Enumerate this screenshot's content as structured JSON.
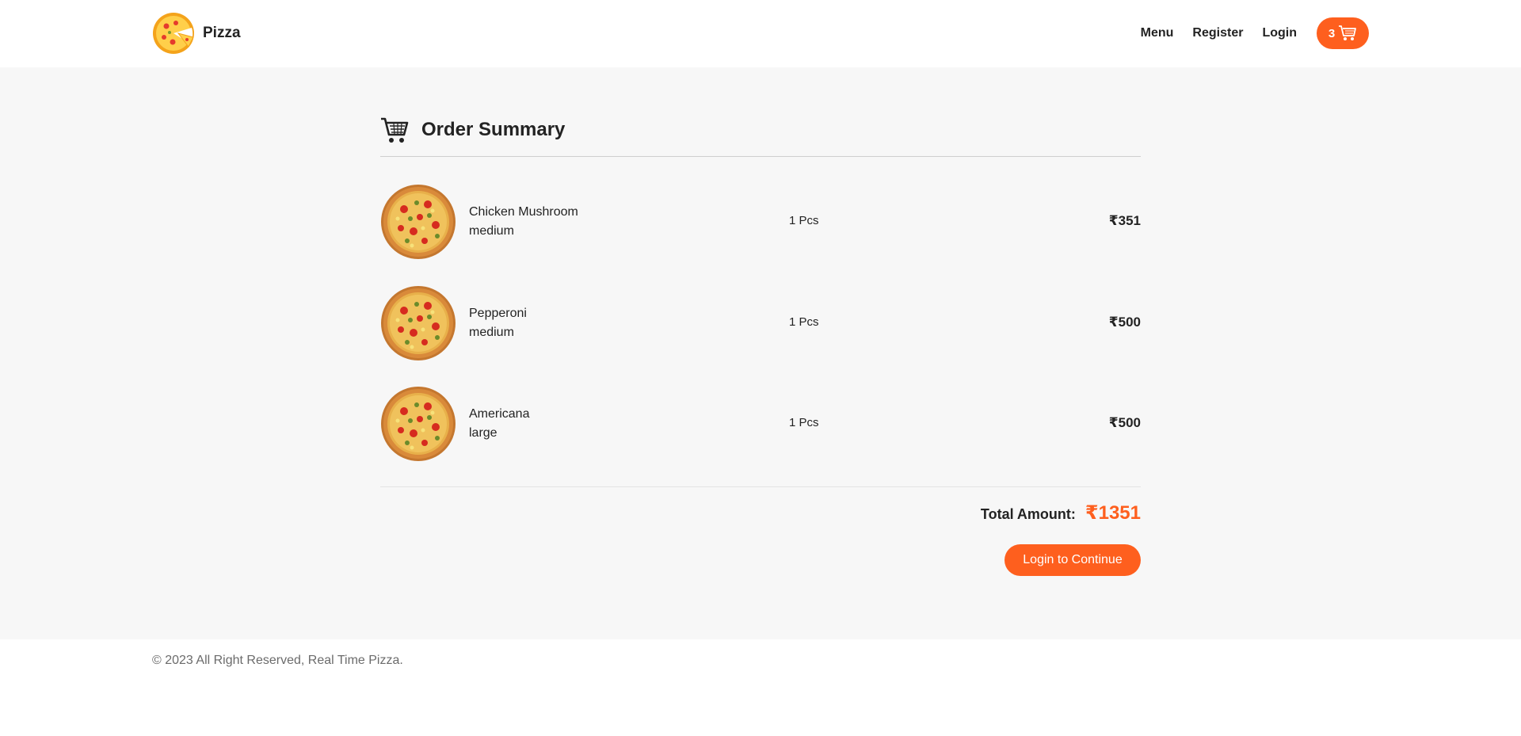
{
  "header": {
    "brand": "Pizza",
    "nav": {
      "menu": "Menu",
      "register": "Register",
      "login": "Login"
    },
    "cart_count": "3"
  },
  "summary": {
    "title": "Order Summary",
    "items": [
      {
        "name": "Chicken Mushroom",
        "size": "medium",
        "qty": "1 Pcs",
        "price": "₹351"
      },
      {
        "name": "Pepperoni",
        "size": "medium",
        "qty": "1 Pcs",
        "price": "₹500"
      },
      {
        "name": "Americana",
        "size": "large",
        "qty": "1 Pcs",
        "price": "₹500"
      }
    ],
    "total_label": "Total Amount:",
    "total_amount": "₹1351",
    "login_button": "Login to Continue"
  },
  "footer": {
    "copyright": "© 2023 All Right Reserved, Real Time Pizza."
  },
  "colors": {
    "accent": "#fe5f1e",
    "main_bg": "#f7f7f7",
    "text": "#232323"
  }
}
